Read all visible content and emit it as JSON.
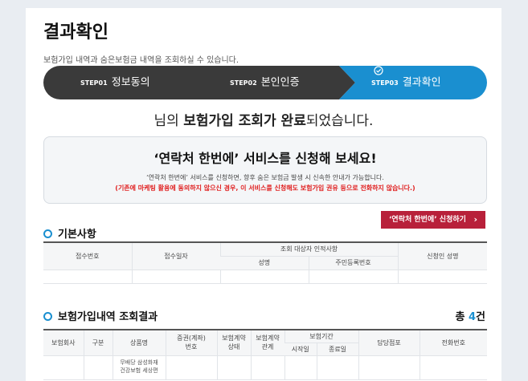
{
  "page": {
    "title": "결과확인",
    "description": "보험가입 내역과 숨은보험금 내역을 조회하실 수 있습니다."
  },
  "steps": [
    {
      "num": "STEP01",
      "name": "정보동의"
    },
    {
      "num": "STEP02",
      "name": "본인인증"
    },
    {
      "num": "STEP03",
      "name": "결과확인",
      "active": true
    }
  ],
  "complete": {
    "prefix": "님의 ",
    "bold": "보험가입 조회가 완료",
    "suffix": "되었습니다."
  },
  "promo": {
    "title": "‘연락처 한번에’ 서비스를 신청해 보세요!",
    "line1": "‘연락처 한번에’ 서비스를 신청하면, 향후 숨은 보험금 발생 시 신속한 안내가 가능합니다.",
    "line2": "(기존에 마케팅 활용에 동의하지 않으신 경우, 이 서비스를 신청해도 보험가입 권유 등으로 전화하지 않습니다.)"
  },
  "apply_button": {
    "label": "‘연락처 한번에’ 신청하기",
    "chevron": "›"
  },
  "basic": {
    "heading": "기본사항",
    "headers": {
      "receipt_no": "접수번호",
      "receipt_date": "접수일자",
      "target": "조회 대상자 인적사항",
      "name": "성명",
      "resident_no": "주민등록번호",
      "applicant": "신청인 성명"
    }
  },
  "results": {
    "heading": "보험가입내역 조회결과",
    "total_prefix": "총 ",
    "total_count": "4",
    "total_suffix": "건",
    "headers": {
      "company": "보험회사",
      "type": "구분",
      "product": "상품명",
      "policy_no_1": "증권(계좌)",
      "policy_no_2": "번호",
      "status_1": "보험계약",
      "status_2": "상태",
      "relation_1": "보험계약",
      "relation_2": "관계",
      "period": "보험기간",
      "start": "시작일",
      "end": "종료일",
      "branch": "담당점포",
      "phone": "전화번호"
    },
    "row_partial": {
      "product_1": "무배당 삼성화재",
      "product_2": "건강보험 세상편"
    }
  },
  "colors": {
    "step_dark": "#3a3a3a",
    "step_active": "#1a8fd0",
    "accent_red": "#b8203a",
    "notice_red": "#e02020"
  }
}
